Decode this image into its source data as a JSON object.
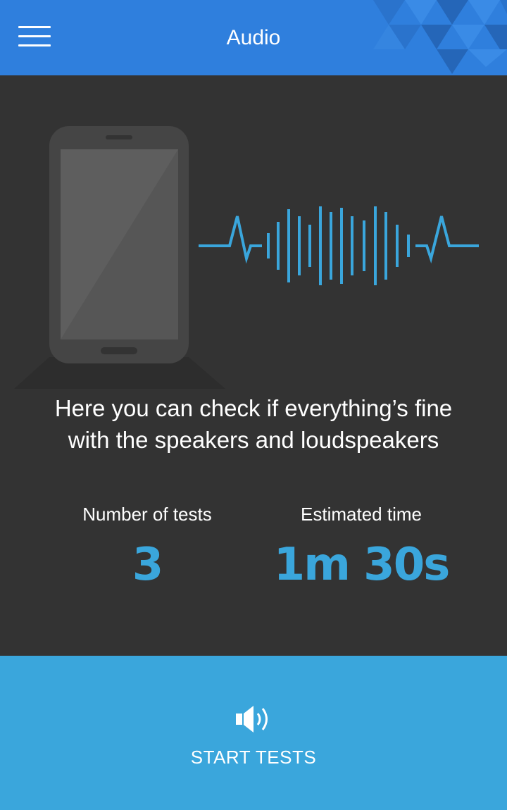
{
  "app_bar": {
    "title": "Audio",
    "background_color": "#2f7fdd",
    "menu_icon": "hamburger-menu-icon"
  },
  "illustration": {
    "phone_icon": "smartphone-icon",
    "waveform_icon": "sound-wave-icon",
    "wave_color": "#3aa6dc"
  },
  "description": {
    "line1": "Here you can check if everything’s fine",
    "line2": "with the speakers and loudspeakers"
  },
  "stats": {
    "tests_label": "Number of tests",
    "tests_value": "3",
    "time_label": "Estimated time",
    "time_value": "1m 30s",
    "accent_color": "#3aa6dc"
  },
  "start": {
    "label": "START TESTS",
    "icon": "speaker-volume-icon",
    "background_color": "#3aa6dc"
  }
}
